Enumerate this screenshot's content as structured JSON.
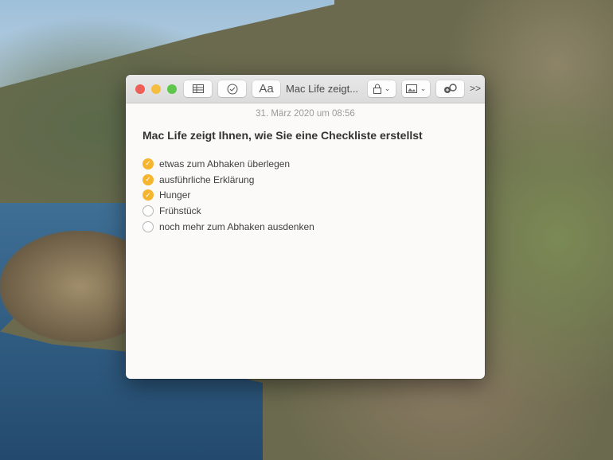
{
  "window": {
    "title": "Mac Life zeigt...",
    "date": "31. März 2020 um 08:56",
    "overflow_label": ">>",
    "font_button_label": "Aa"
  },
  "note": {
    "heading": "Mac Life zeigt Ihnen, wie Sie eine Checkliste erstellst",
    "items": [
      {
        "text": "etwas zum Abhaken überlegen",
        "checked": true
      },
      {
        "text": "ausführliche Erklärung",
        "checked": true
      },
      {
        "text": "Hunger",
        "checked": true
      },
      {
        "text": "Frühstück",
        "checked": false
      },
      {
        "text": "noch mehr zum Abhaken ausdenken",
        "checked": false
      }
    ]
  },
  "colors": {
    "accent": "#f5b52e",
    "close": "#ed5f57",
    "minimize": "#f5be3f",
    "zoom": "#5ec74b"
  }
}
